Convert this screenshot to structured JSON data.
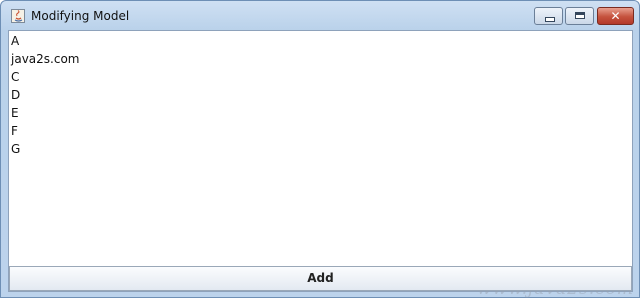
{
  "window": {
    "title": "Modifying Model",
    "app_icon": "java-icon",
    "controls": [
      "minimize-icon",
      "maximize-icon",
      "close-icon"
    ]
  },
  "list": {
    "items": [
      "A",
      "java2s.com",
      "C",
      "D",
      "E",
      "F",
      "G"
    ]
  },
  "add_button": {
    "label": "Add"
  },
  "watermark": "www.java2s.com"
}
